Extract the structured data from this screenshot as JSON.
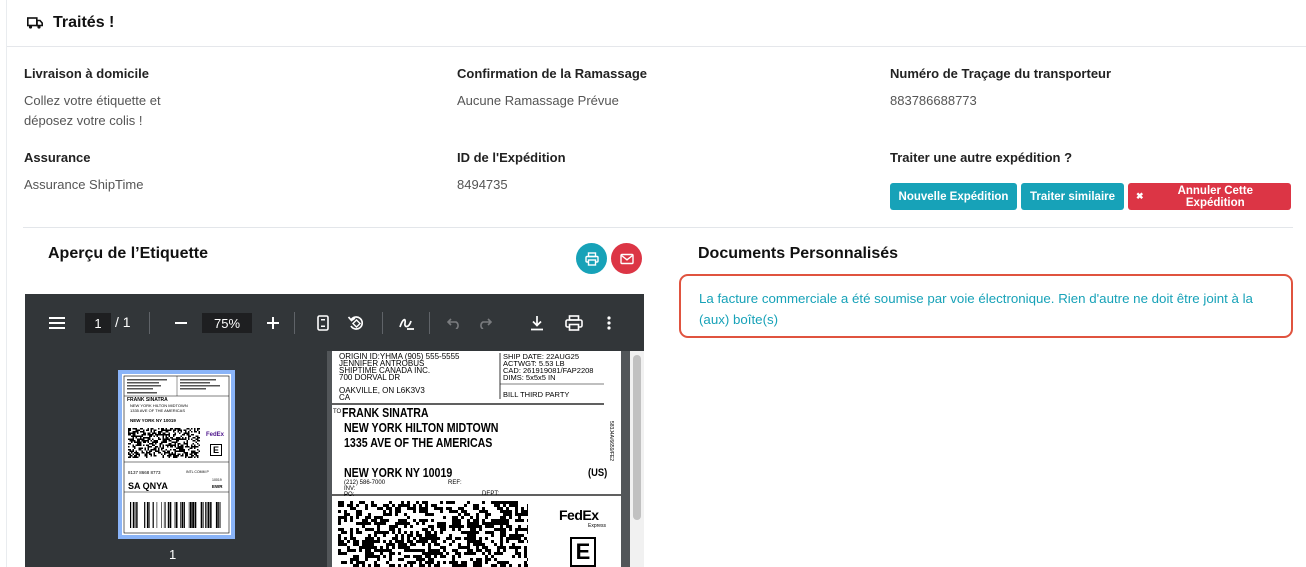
{
  "header": {
    "title": "Traités !",
    "icon": "truck-icon"
  },
  "info": {
    "delivery_label": "Livraison à domicile",
    "delivery_value_line1": "Collez votre étiquette et",
    "delivery_value_line2": "déposez votre colis !",
    "pickup_label": "Confirmation de la Ramassage",
    "pickup_value": "Aucune Ramassage Prévue",
    "tracking_label": "Numéro de Traçage du transporteur",
    "tracking_value": "883786688773",
    "insurance_label": "Assurance",
    "insurance_value": "Assurance ShipTime",
    "shipment_id_label": "ID de l'Expédition",
    "shipment_id_value": "8494735",
    "another_label": "Traiter une autre expédition ?"
  },
  "actions": {
    "new_shipment": "Nouvelle Expédition",
    "similar": "Traiter similaire",
    "cancel": "Annuler Cette Expédition",
    "cancel_icon": "✖"
  },
  "label_preview": {
    "title": "Aperçu de l’Etiquette"
  },
  "custom_docs": {
    "title": "Documents Personnalisés",
    "notice": "La facture commerciale a été soumise par voie électronique. Rien d'autre ne doit être joint à la (aux) boîte(s)"
  },
  "viewer": {
    "page_current": "1",
    "page_total": "/ 1",
    "zoom": "75%",
    "thumb_number": "1"
  },
  "shipping_label": {
    "origin_line1": "ORIGIN ID:YHMA     (905) 555-5555",
    "origin_line2": "JENNIFER ANTROBUS",
    "origin_line3": "SHIPTIME CANADA INC.",
    "origin_line4": "700 DORVAL DR",
    "origin_line5": "OAKVILLE, ON L6K3V3",
    "origin_line6": "CA",
    "ship_date": "SHIP DATE: 22AUG25",
    "actwgt": "ACTWGT: 5.53 LB",
    "cad": "CAD: 261919081/FAP2208",
    "dims": "DIMS: 5x5x5 IN",
    "bill": "BILL THIRD PARTY",
    "to_prefix": "TO",
    "to_name": "FRANK SINATRA",
    "to_line2": "NEW YORK HILTON MIDTOWN",
    "to_line3": "1335 AVE OF THE AMERICAS",
    "to_city": "NEW YORK NY 10019",
    "country": "(US)",
    "phone": "(212) 586-7000",
    "ref": "REF:",
    "inv": "INV:",
    "po": "PO:",
    "dept": "DEPT:",
    "side_code": "583J4A/6659/FE2",
    "fedex_fed": "Fed",
    "fedex_ex": "Ex",
    "fedex_express": "Express",
    "e_mark": "E"
  },
  "thumbnail_label": {
    "name": "FRANK SINATRA",
    "line2": "NEW YORK HILTON MIDTOWN",
    "line3": "1335 AVE OF THE AMERICAS",
    "city": "NEW YORK NY 10019",
    "tracking": "8137 8668 8773",
    "routing": "SA QNYA",
    "svc": "INTL COMM P",
    "zip": "10019",
    "ewr": "EWR",
    "fedex": "FedEx",
    "e_mark": "E"
  }
}
